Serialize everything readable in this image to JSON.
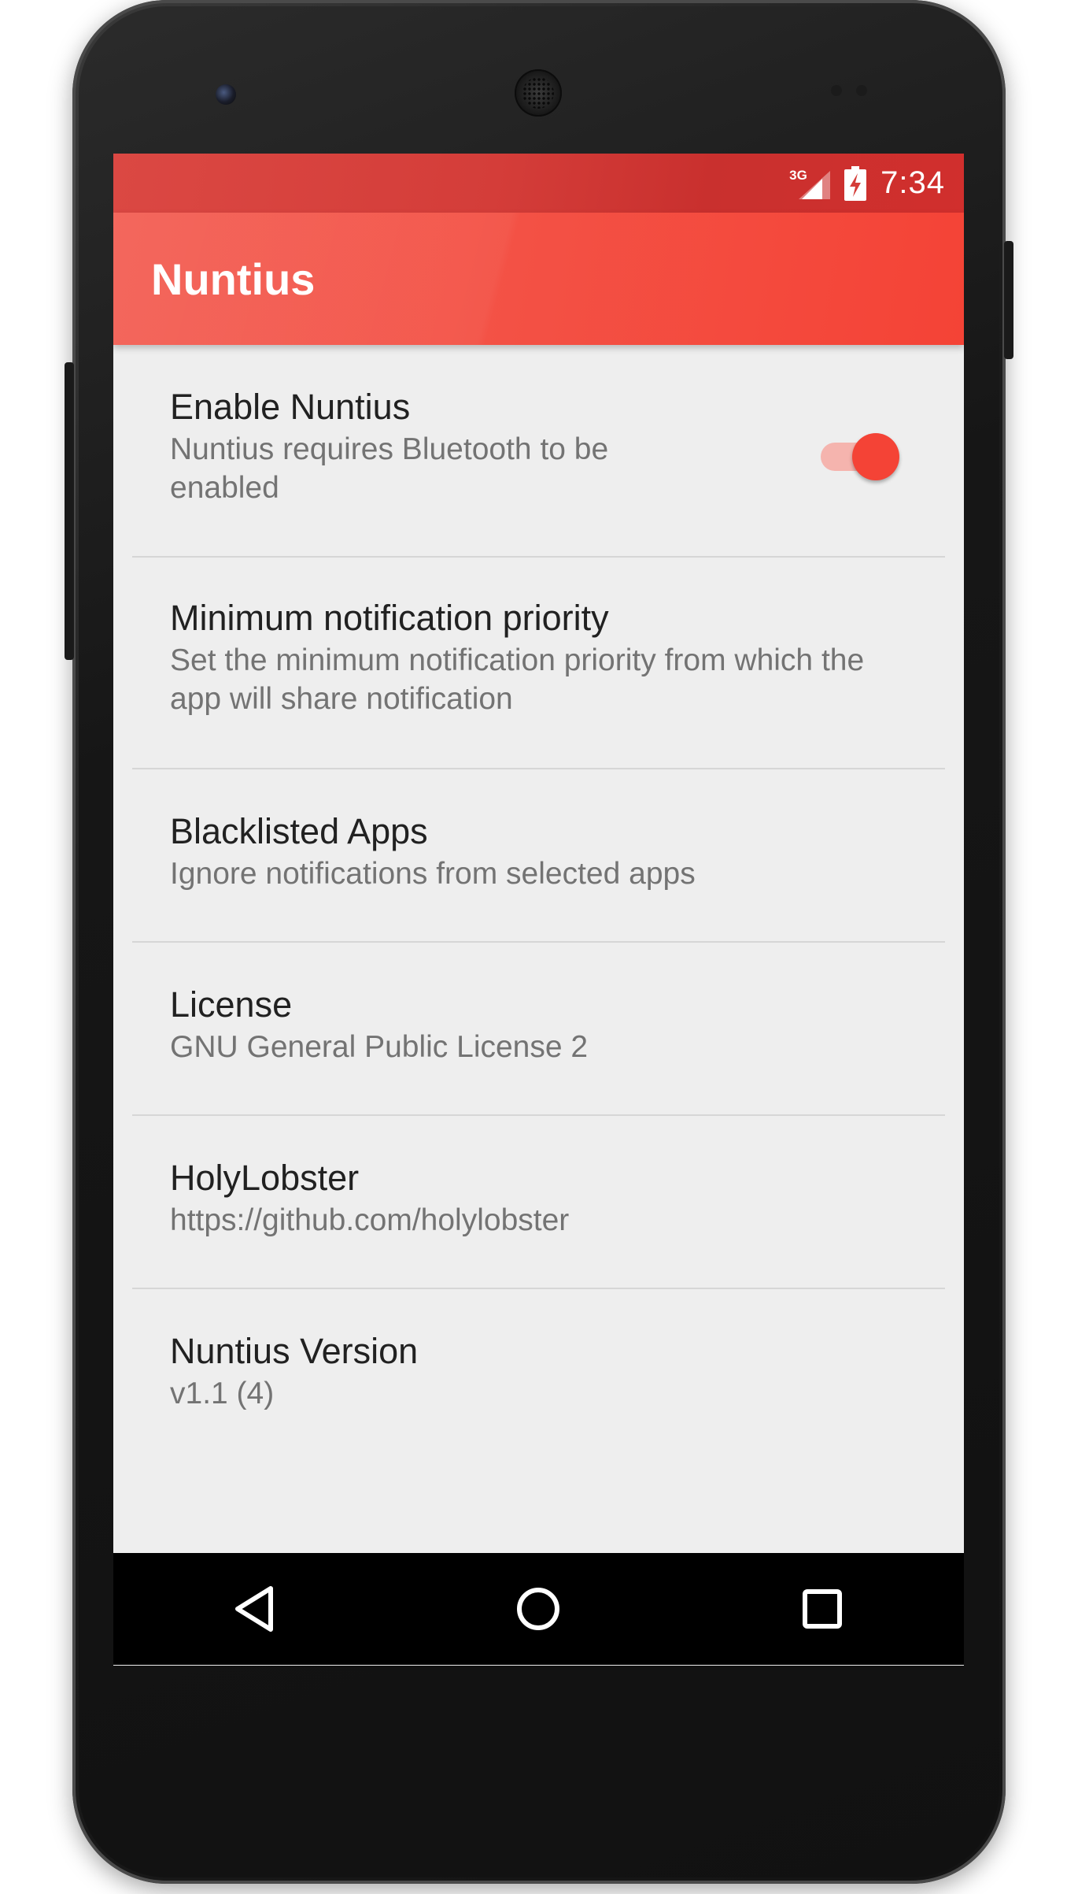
{
  "status_bar": {
    "network": "3G",
    "time": "7:34"
  },
  "app_bar": {
    "title": "Nuntius"
  },
  "preferences": [
    {
      "title": "Enable Nuntius",
      "summary": "Nuntius requires Bluetooth to be enabled",
      "switch_on": true
    },
    {
      "title": "Minimum notification priority",
      "summary": "Set the minimum notification priority from which the app will share notification"
    },
    {
      "title": "Blacklisted Apps",
      "summary": "Ignore notifications from selected apps"
    },
    {
      "title": "License",
      "summary": "GNU General Public License 2"
    },
    {
      "title": "HolyLobster",
      "summary": "https://github.com/holylobster"
    },
    {
      "title": "Nuntius Version",
      "summary": "v1.1 (4)"
    }
  ],
  "nav_bar": {
    "back_icon": "back-triangle",
    "home_icon": "home-circle",
    "recents_icon": "recents-square"
  },
  "colors": {
    "primary": "#f44336",
    "primary_dark": "#d32f2f",
    "switch_track": "#f5b4ae",
    "background": "#eeeeee"
  }
}
